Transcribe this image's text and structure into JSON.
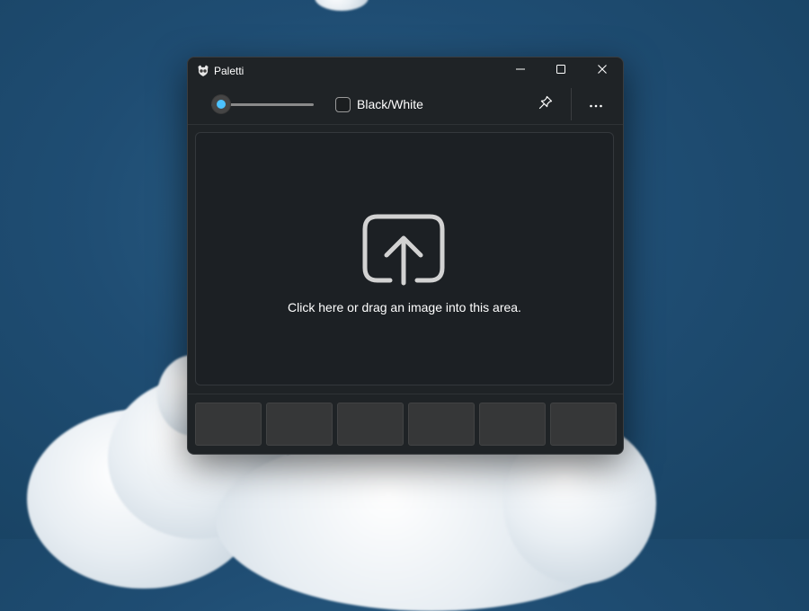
{
  "window": {
    "title": "Paletti",
    "app_icon": "paletti-cat-icon"
  },
  "caption_buttons": {
    "minimize_icon": "minimize-icon",
    "maximize_icon": "maximize-icon",
    "close_icon": "close-icon"
  },
  "toolbar": {
    "slider_value": 0.1,
    "checkbox_label": "Black/White",
    "checkbox_checked": false,
    "pin_icon": "pin-icon",
    "more_icon": "more-options-icon"
  },
  "dropzone": {
    "icon": "upload-share-icon",
    "text": "Click here or drag an image into this area."
  },
  "palette": {
    "swatch_count": 6,
    "swatches": [
      "",
      "",
      "",
      "",
      "",
      ""
    ]
  },
  "colors": {
    "accent": "#4cc2ff",
    "window_bg": "#1f2326",
    "dropzone_bg": "#1c2024",
    "swatch_bg": "#363738",
    "desktop_sky": "#1f4d73"
  }
}
